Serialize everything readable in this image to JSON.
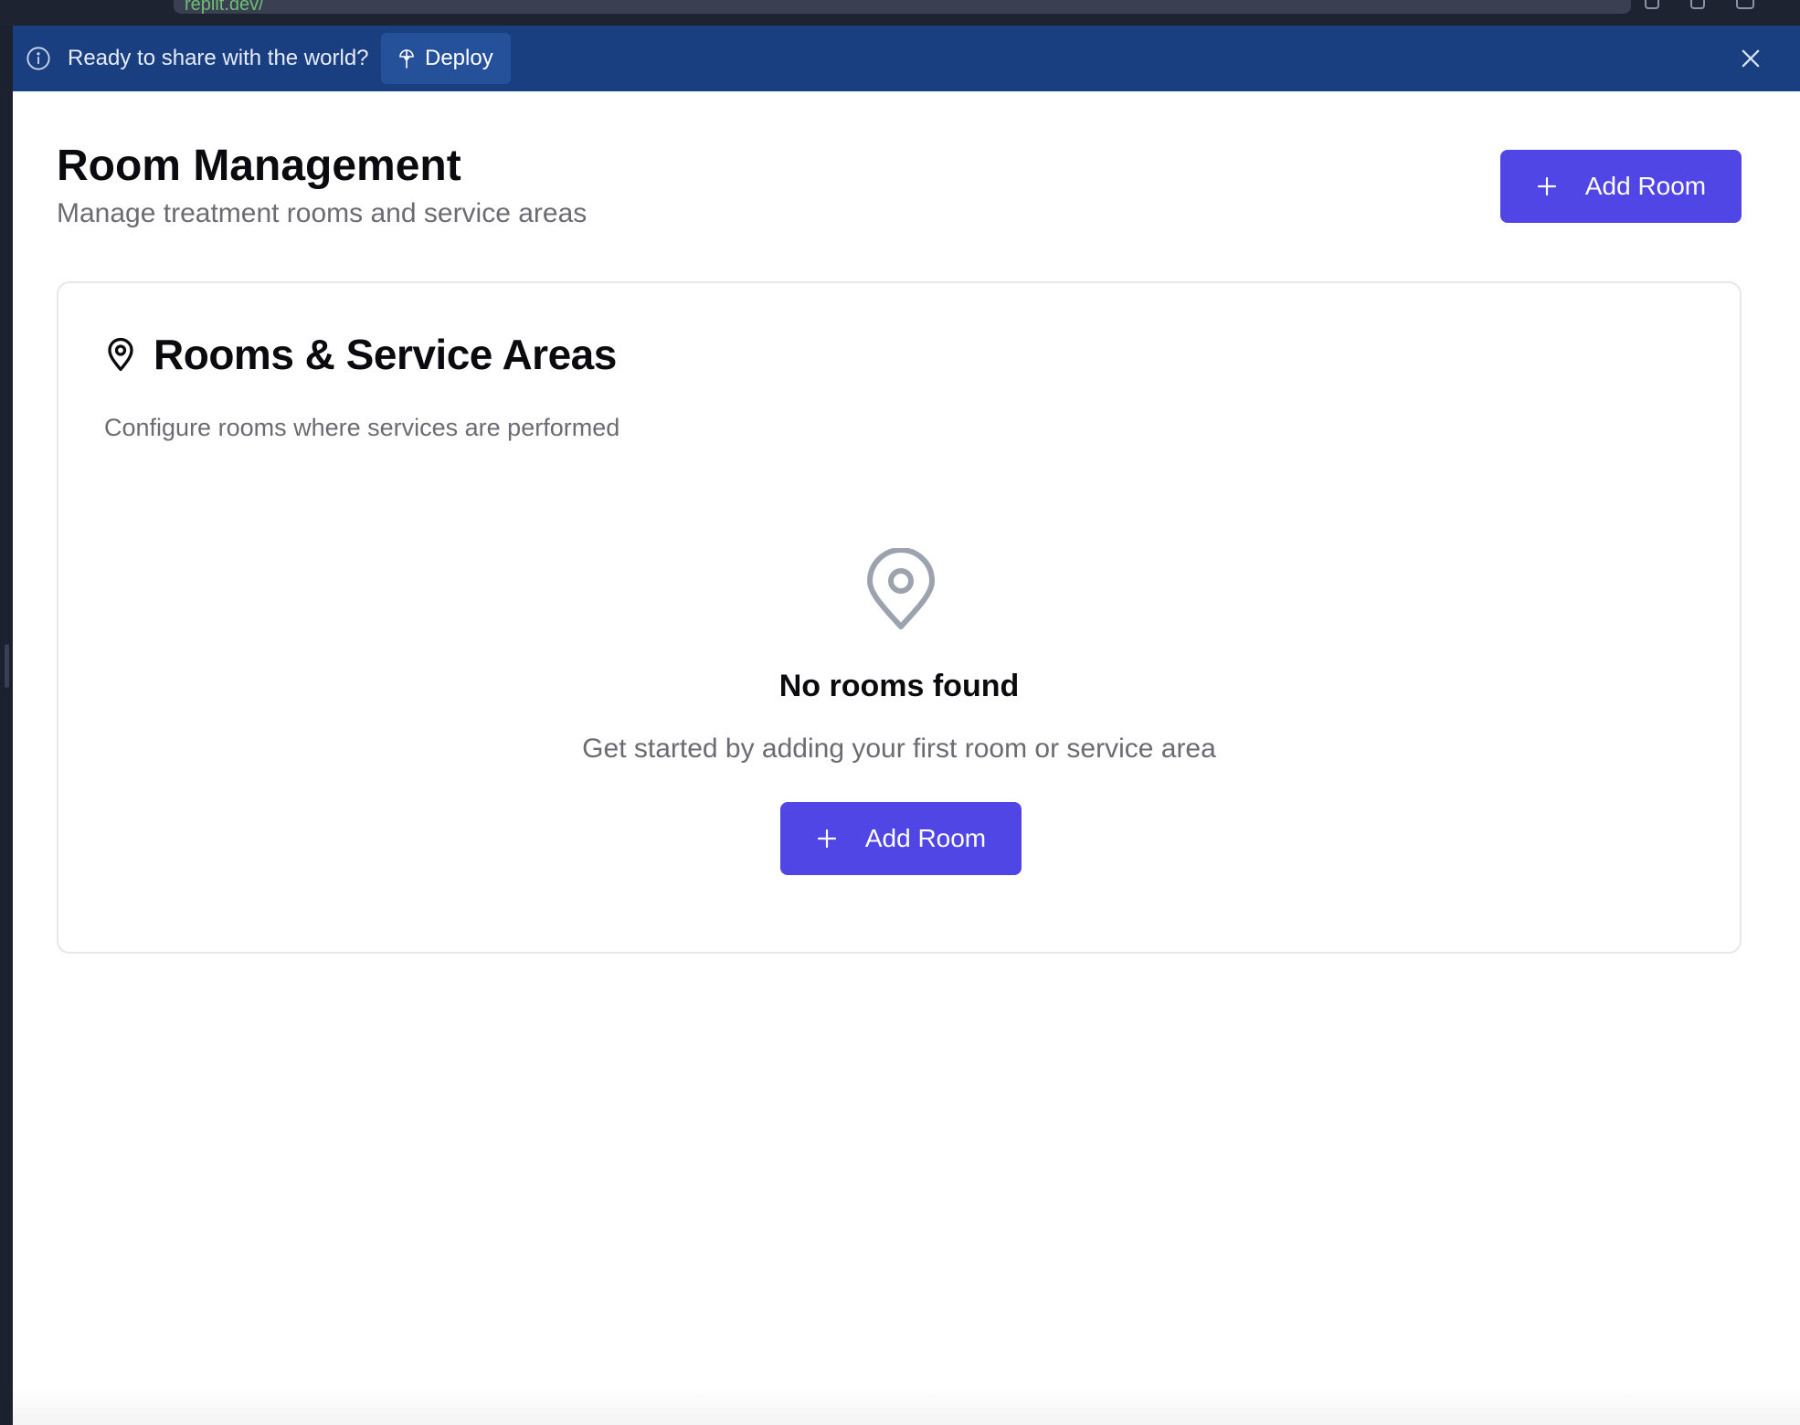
{
  "browser": {
    "url": "replit.dev/"
  },
  "banner": {
    "message": "Ready to share with the world?",
    "deploy_label": "Deploy"
  },
  "header": {
    "title": "Room Management",
    "subtitle": "Manage treatment rooms and service areas",
    "add_button_label": "Add Room"
  },
  "card": {
    "title": "Rooms & Service Areas",
    "subtitle": "Configure rooms where services are performed",
    "empty_state": {
      "title": "No rooms found",
      "message": "Get started by adding your first room or service area",
      "add_button_label": "Add Room"
    }
  },
  "icons": {
    "banner_info": "info-icon",
    "deploy": "deploy-icon",
    "close": "close-icon",
    "plus": "plus-icon",
    "map_pin": "map-pin-icon"
  },
  "colors": {
    "banner_bg": "#1a3f80",
    "deploy_button_bg": "#24519a",
    "primary_button": "#4f46e5",
    "empty_icon": "#9ca3af",
    "muted_text": "#6b6b73"
  }
}
